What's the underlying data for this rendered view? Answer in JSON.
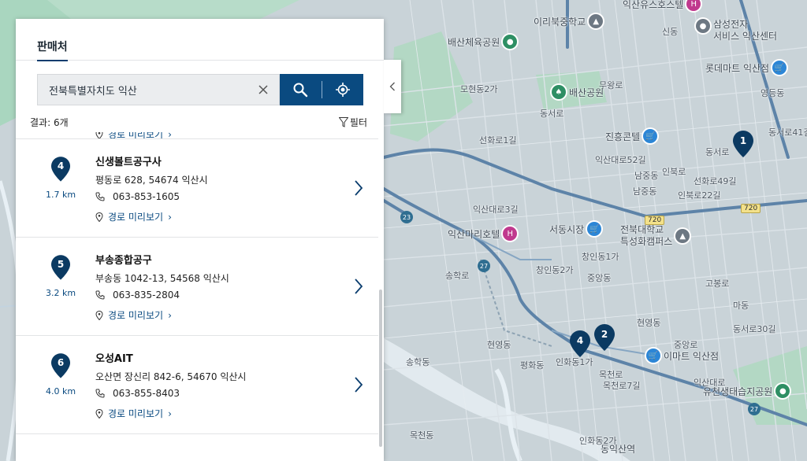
{
  "panel": {
    "tab_label": "판매처",
    "search": {
      "value": "전북특별자치도 익산",
      "placeholder": ""
    },
    "result_count": "결과: 6개",
    "filter_label": "필터",
    "route_label": "경로 미리보기",
    "items": [
      {
        "number": "4",
        "distance": "1.7 km",
        "name": "신생볼트공구사",
        "address": "평동로 628, 54674 익산시",
        "phone": "063-853-1605"
      },
      {
        "number": "5",
        "distance": "3.2 km",
        "name": "부송종합공구",
        "address": "부송동 1042-13, 54568 익산시",
        "phone": "063-835-2804"
      },
      {
        "number": "6",
        "distance": "4.0 km",
        "name": "오성AIT",
        "address": "오산면 장신리 842-6, 54670 익산시",
        "phone": "063-855-8403"
      }
    ]
  },
  "map": {
    "markers": [
      "1",
      "2",
      "4"
    ],
    "road_badges": [
      "720",
      "720"
    ],
    "route_numbers": [
      "23",
      "27",
      "27"
    ],
    "pois": [
      {
        "label": "익산유스호스텔",
        "type": "hotel"
      },
      {
        "label": "이리북중학교",
        "type": "school"
      },
      {
        "label": "삼성전자\n서비스 익산센터",
        "type": "service"
      },
      {
        "label": "배산체육공원",
        "type": "park"
      },
      {
        "label": "롯데마트 익산점",
        "type": "shop"
      },
      {
        "label": "배산공원",
        "type": "park"
      },
      {
        "label": "진흥콘텔",
        "type": "shop"
      },
      {
        "label": "익산마리호텔",
        "type": "hotel"
      },
      {
        "label": "서동시장",
        "type": "shop"
      },
      {
        "label": "전북대학교\n특성화캠퍼스",
        "type": "school"
      },
      {
        "label": "이마트 익산점",
        "type": "shop"
      },
      {
        "label": "유천생태습지공원",
        "type": "park"
      },
      {
        "label": "동익산역",
        "type": "station"
      }
    ],
    "street_labels": [
      "모현동2가",
      "송학로",
      "동서로",
      "선화로1길",
      "무왕로",
      "인북로",
      "선화로49길",
      "인북로22길",
      "익산대로52길",
      "남중동",
      "익산대로3길",
      "창인동1가",
      "신동",
      "영등동",
      "동서로41길",
      "고봉로",
      "중앙동",
      "남중동",
      "평화동",
      "인화동1가",
      "목천로",
      "목천로7길",
      "익산대로",
      "동서로",
      "송학동",
      "인화동2가",
      "목천동",
      "현영동",
      "현영동",
      "동서로30길",
      "중앙로",
      "마동",
      "창인동2가"
    ]
  },
  "colors": {
    "accent": "#0a4a80",
    "marker": "#0b3a62",
    "map_bg": "#c9d3d8",
    "park": "#9fd2b6",
    "road": "#5d83a8"
  }
}
